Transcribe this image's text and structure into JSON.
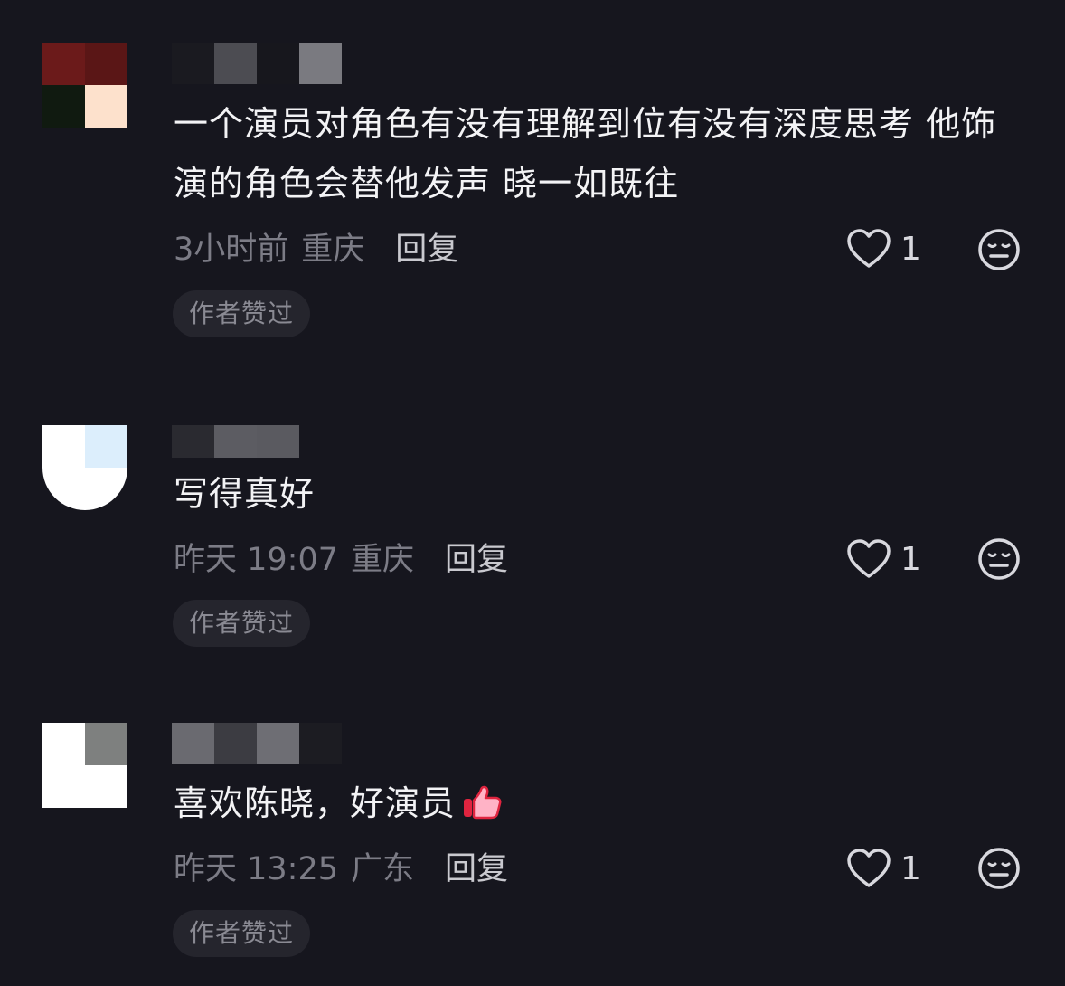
{
  "comments": [
    {
      "text": "一个演员对角色有没有理解到位有没有深度思考 他饰演的角色会替他发声  晓一如既往",
      "time": "3小时前",
      "region": "重庆",
      "reply_label": "回复",
      "like_count": "1",
      "badge": "作者赞过"
    },
    {
      "text": "写得真好",
      "time": "昨天 19:07",
      "region": "重庆",
      "reply_label": "回复",
      "like_count": "1",
      "badge": "作者赞过"
    },
    {
      "text": "喜欢陈晓，好演员",
      "time": "昨天 13:25",
      "region": "广东",
      "reply_label": "回复",
      "like_count": "1",
      "badge": "作者赞过",
      "emoji": "thumbs-up-icon"
    }
  ],
  "icons": {
    "like": "heart-outline-icon",
    "dislike": "meh-face-icon"
  },
  "colors": {
    "background": "#16161e",
    "text_primary": "#f3f3f5",
    "text_secondary": "#7c7c86",
    "badge_bg": "#25252d"
  }
}
